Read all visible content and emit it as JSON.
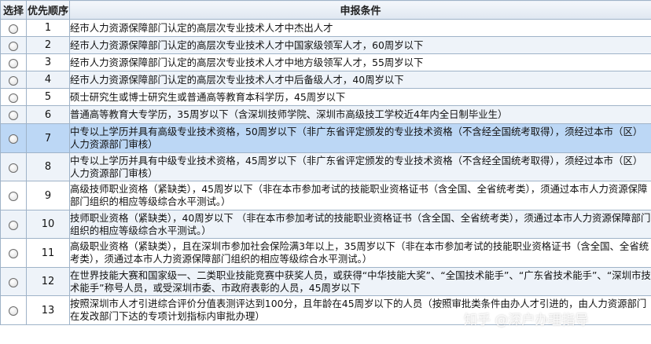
{
  "header": {
    "select_label": "选择",
    "priority_label": "优先顺序",
    "conditions_label": "申报条件"
  },
  "rows": [
    {
      "order": "1",
      "condition": "经市人力资源保障部门认定的高层次专业技术人才中杰出人才"
    },
    {
      "order": "2",
      "condition": "经市人力资源保障部门认定的高层次专业技术人才中国家级领军人才，60周岁以下"
    },
    {
      "order": "3",
      "condition": "经市人力资源保障部门认定的高层次专业技术人才中地方级领军人才，55周岁以下"
    },
    {
      "order": "4",
      "condition": "经市人力资源保障部门认定的高层次专业技术人才中后备级人才，40周岁以下"
    },
    {
      "order": "5",
      "condition": "硕士研究生或博士研究生或普通高等教育本科学历，45周岁以下"
    },
    {
      "order": "6",
      "condition": "普通高等教育大专学历，35周岁以下（含深圳技师学院、深圳市高级技工学校近4年内全日制毕业生）"
    },
    {
      "order": "7",
      "condition": "中专以上学历并具有高级专业技术资格，50周岁以下（非广东省评定颁发的专业技术资格（不含经全国统考取得），须经过本市（区）人力资源部门审核）"
    },
    {
      "order": "8",
      "condition": "中专以上学历并具有中级专业技术资格，45周岁以下（非广东省评定颁发的专业技术资格（不含经全国统考取得），须经过本市（区）人力资源部门审核）"
    },
    {
      "order": "9",
      "condition": "高级技师职业资格（紧缺类），45周岁以下（非在本市参加考试的技能职业资格证书（含全国、全省统考类），须通过本市人力资源保障部门组织的相应等级综合水平测试。）"
    },
    {
      "order": "10",
      "condition": "技师职业资格（紧缺类），40周岁以下 （非在本市参加考试的技能职业资格证书（含全国、全省统考类），须通过本市人力资源保障部门组织的相应等级综合水平测试。）"
    },
    {
      "order": "11",
      "condition": "高级职业资格（紧缺类），且在深圳市参加社会保险满3年以上，35周岁以下（非在本市参加考试的技能职业资格证书（含全国、全省统考类），须通过本市人力资源保障部门组织的相应等级综合水平测试。）"
    },
    {
      "order": "12",
      "condition": "在世界技能大赛和国家级一、二类职业技能竞赛中获奖人员，或获得“中华技能大奖”、“全国技术能手”、“广东省技术能手”、“深圳市技术能手”称号人员，或受深圳市委、市政府表彰的人员，45周岁以下"
    },
    {
      "order": "13",
      "condition": "按照深圳市人才引进综合评价分值表测评达到100分，且年龄在45周岁以下的人员（按照审批类条件由办人才引进的，由人力资源部门在发改部门下达的专项计划指标内审批办理）"
    }
  ],
  "highlighted_order": "7",
  "watermark": "知乎 @深户办理指导",
  "colors": {
    "border": "#9fb3c8",
    "row_alt": "#eef3f9",
    "row_highlight": "#bcd7f5",
    "header_bg": "#dfe7f1"
  }
}
